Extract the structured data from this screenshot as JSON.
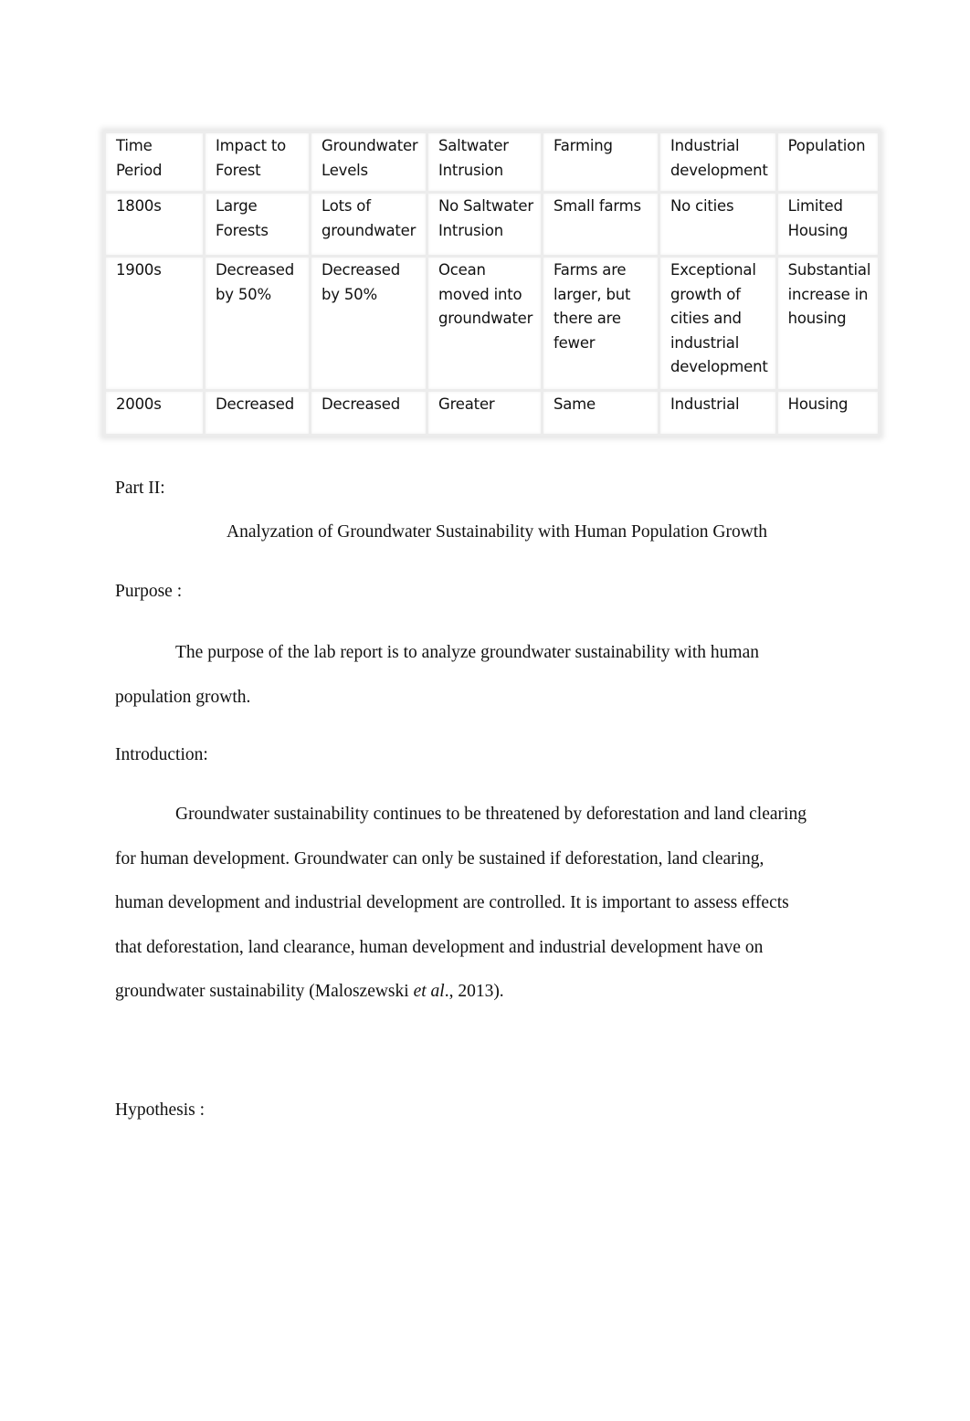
{
  "table": {
    "headers": [
      "Time Period",
      "Impact to Forest",
      "Groundwater Levels",
      "Saltwater Intrusion",
      "Farming",
      "Industrial development",
      "Population"
    ],
    "rows": [
      [
        "1800s",
        "Large Forests",
        "Lots of groundwater",
        "No Saltwater Intrusion",
        "Small farms",
        "No cities",
        "Limited Housing"
      ],
      [
        "1900s",
        "Decreased by 50%",
        "Decreased by 50%",
        "Ocean moved into groundwater",
        "Farms are larger, but there are fewer",
        "Exceptional growth of cities and industrial development",
        "Substantial increase in housing"
      ],
      [
        "2000s",
        "Decreased",
        "Decreased",
        "Greater",
        "Same",
        "Industrial",
        "Housing"
      ]
    ]
  },
  "document": {
    "part_label": "Part II:",
    "title": "Analyzation of Groundwater Sustainability with Human Population Growth",
    "purpose_heading": "Purpose :",
    "purpose_lines": [
      "The purpose of the lab report is to analyze groundwater sustainability with human",
      "population growth."
    ],
    "introduction_heading": "Introduction:",
    "introduction_lines": [
      "Groundwater sustainability continues to be threatened by deforestation and land clearing",
      "for human development. Groundwater can only be sustained if deforestation, land clearing,",
      "human development and industrial development are controlled. It is important to assess effects",
      "that deforestation, land clearance, human development and industrial development have on"
    ],
    "introduction_last_line": {
      "before": "groundwater sustainability (Maloszewski ",
      "italic": "et al",
      "after": "., 2013)."
    },
    "hypothesis_heading": "Hypothesis :"
  }
}
